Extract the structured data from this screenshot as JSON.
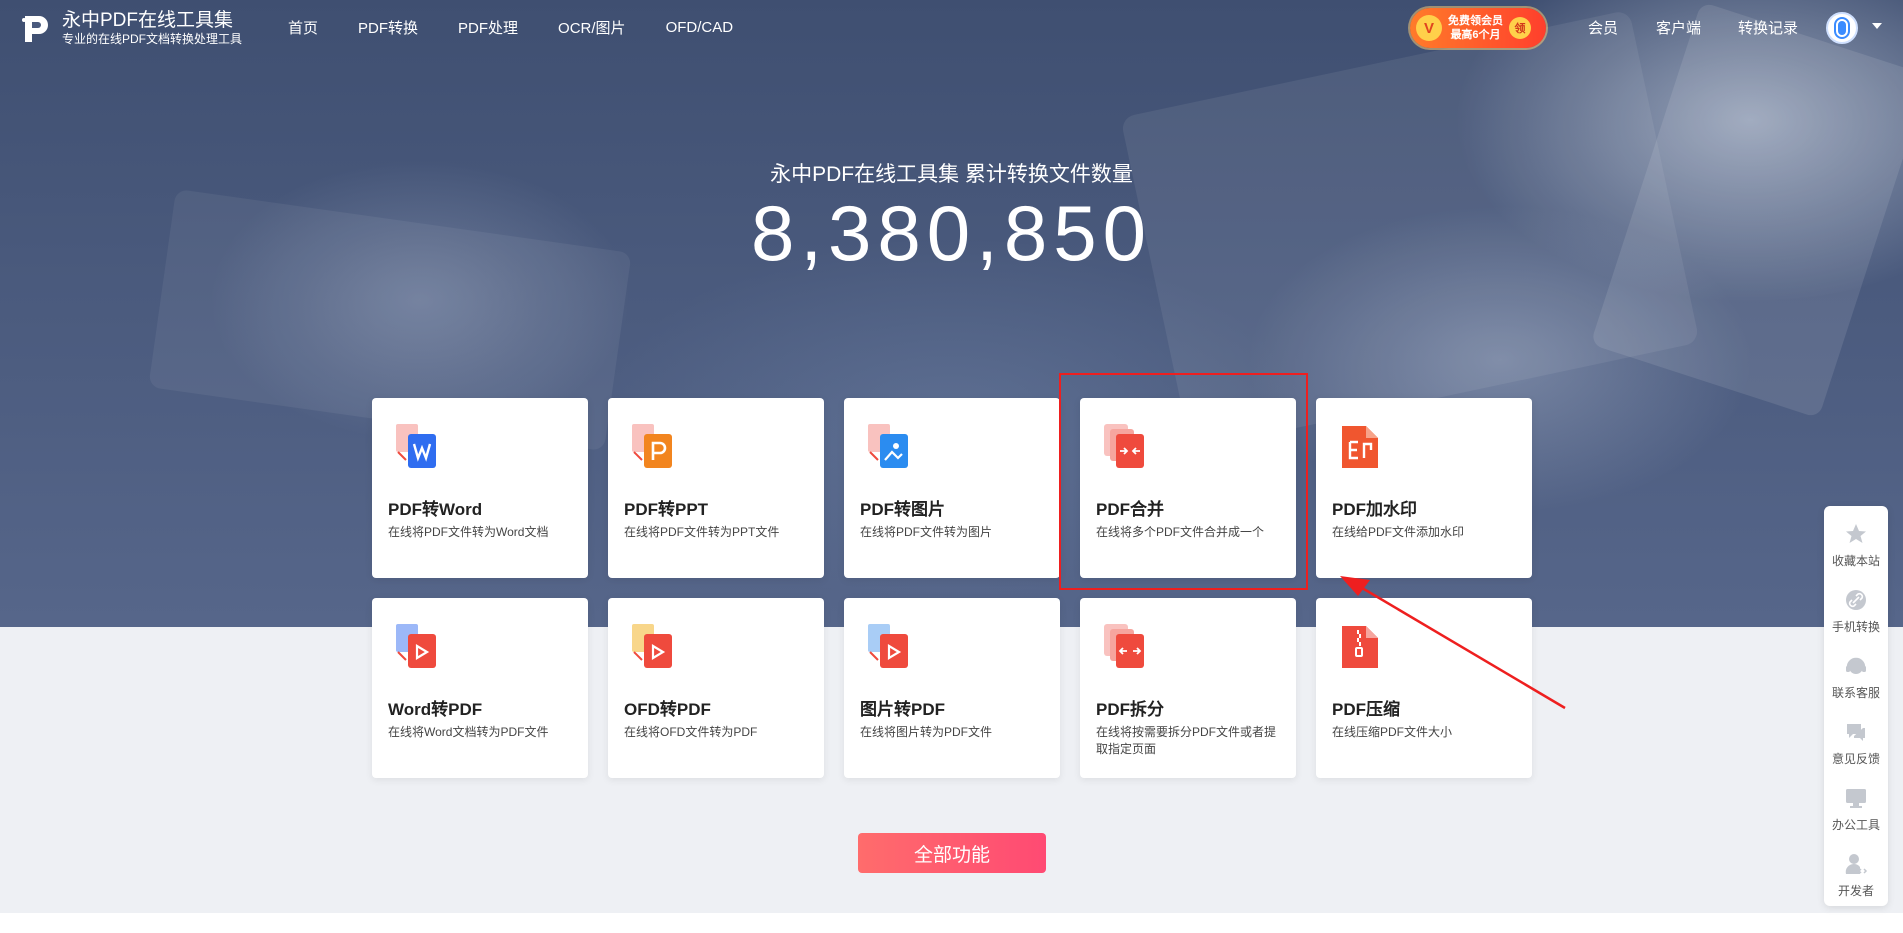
{
  "header": {
    "logo_title": "永中PDF在线工具集",
    "logo_subtitle": "专业的在线PDF文档转换处理工具",
    "nav": [
      "首页",
      "PDF转换",
      "PDF处理",
      "OCR/图片",
      "OFD/CAD"
    ],
    "vip_line1": "免费领会员",
    "vip_line2": "最高6个月",
    "vip_gift": "领",
    "member": "会员",
    "client": "客户端",
    "history": "转换记录"
  },
  "hero": {
    "subtitle": "永中PDF在线工具集  累计转换文件数量",
    "count": "8,380,850"
  },
  "tools": [
    {
      "title": "PDF转Word",
      "desc": "在线将PDF文件转为Word文档",
      "icon": "pdf-to-word-icon",
      "color": "#2f6df0"
    },
    {
      "title": "PDF转PPT",
      "desc": "在线将PDF文件转为PPT文件",
      "icon": "pdf-to-ppt-icon",
      "color": "#f2851f"
    },
    {
      "title": "PDF转图片",
      "desc": "在线将PDF文件转为图片",
      "icon": "pdf-to-image-icon",
      "color": "#2b8cf0"
    },
    {
      "title": "PDF合并",
      "desc": "在线将多个PDF文件合并成一个",
      "icon": "pdf-merge-icon",
      "color": "#ef4a3d"
    },
    {
      "title": "PDF加水印",
      "desc": "在线给PDF文件添加水印",
      "icon": "pdf-watermark-icon",
      "color": "#f0562f"
    },
    {
      "title": "Word转PDF",
      "desc": "在线将Word文档转为PDF文件",
      "icon": "word-to-pdf-icon",
      "color": "#ef4a3d"
    },
    {
      "title": "OFD转PDF",
      "desc": "在线将OFD文件转为PDF",
      "icon": "ofd-to-pdf-icon",
      "color": "#ef4a3d"
    },
    {
      "title": "图片转PDF",
      "desc": "在线将图片转为PDF文件",
      "icon": "image-to-pdf-icon",
      "color": "#ef4a3d"
    },
    {
      "title": "PDF拆分",
      "desc": "在线将按需要拆分PDF文件或者提取指定页面",
      "icon": "pdf-split-icon",
      "color": "#ef4a3d"
    },
    {
      "title": "PDF压缩",
      "desc": "在线压缩PDF文件大小",
      "icon": "pdf-compress-icon",
      "color": "#ef4a3d"
    }
  ],
  "all_button": "全部功能",
  "sidebar": [
    "收藏本站",
    "手机转换",
    "联系客服",
    "意见反馈",
    "办公工具",
    "开发者"
  ]
}
